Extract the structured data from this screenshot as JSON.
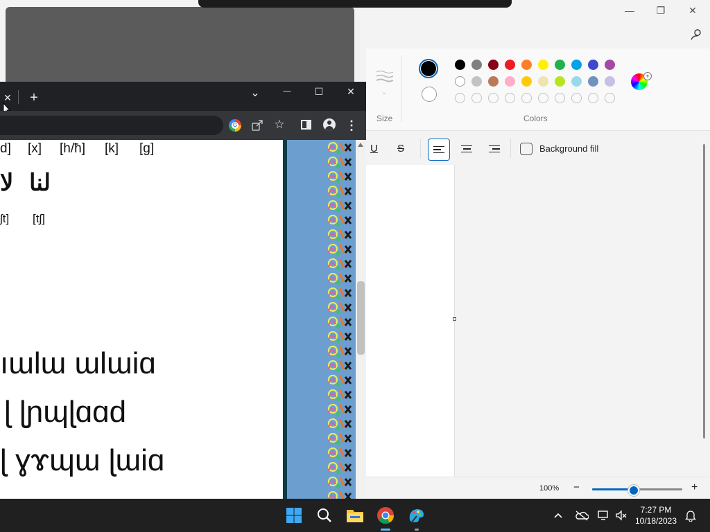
{
  "paint": {
    "ribbon": {
      "size_label": "Size",
      "colors_label": "Colors",
      "palette_row1": [
        "#000000",
        "#7f7f7f",
        "#880015",
        "#ed1c24",
        "#ff7f27",
        "#fff200",
        "#22b14c",
        "#00a2e8",
        "#3f48cc",
        "#a349a4"
      ],
      "palette_row2": [
        "#ffffff",
        "#c3c3c3",
        "#b97a57",
        "#ffaec9",
        "#ffc90e",
        "#efe4b0",
        "#b5e61d",
        "#99d9ea",
        "#7092be",
        "#c8bfe7"
      ],
      "palette_row3_count": 10,
      "primary_color": "#000000",
      "secondary_color": "#ffffff"
    },
    "text_toolbar": {
      "underline_glyph": "U",
      "strike_glyph": "S",
      "background_fill_label": "Background fill"
    },
    "status": {
      "zoom": "100%",
      "zoom_out_glyph": "−",
      "zoom_in_glyph": "+",
      "zoom_level": 0.45
    },
    "caption": {
      "minimize_glyph": "—",
      "maximize_glyph": "❐",
      "close_glyph": "✕"
    }
  },
  "chrome": {
    "tab_close_glyph": "✕",
    "new_tab_glyph": "+",
    "caption": {
      "dropdown_glyph": "⌄",
      "minimize_glyph": "—",
      "maximize_glyph": "☐",
      "close_glyph": "✕"
    },
    "toolbar": {
      "google_glyph": "G",
      "star_glyph": "☆",
      "menu_glyph": "⋮"
    },
    "page": {
      "ipa_row": [
        "d]",
        "[x]",
        "[h/ħ]",
        "[k]",
        "[g]"
      ],
      "script_row": [
        "ﻟﺎ",
        "ﻟﻨﺎ"
      ],
      "ipa_row2": [
        "ʃt]",
        "[tʃ]"
      ],
      "script_line1": "ıɯlɯ ɯlɯiɑ",
      "script_line2": "ɭ ɭɲɰɭɑɑd",
      "script_line3": "ɭ ɣɤɰɯ ɭɯiɑ"
    }
  },
  "taskbar": {
    "clock_time": "7:27 PM",
    "clock_date": "10/18/2023",
    "icons": [
      "windows-start-icon",
      "search-icon",
      "file-explorer-icon",
      "chrome-icon",
      "paint-icon"
    ]
  }
}
